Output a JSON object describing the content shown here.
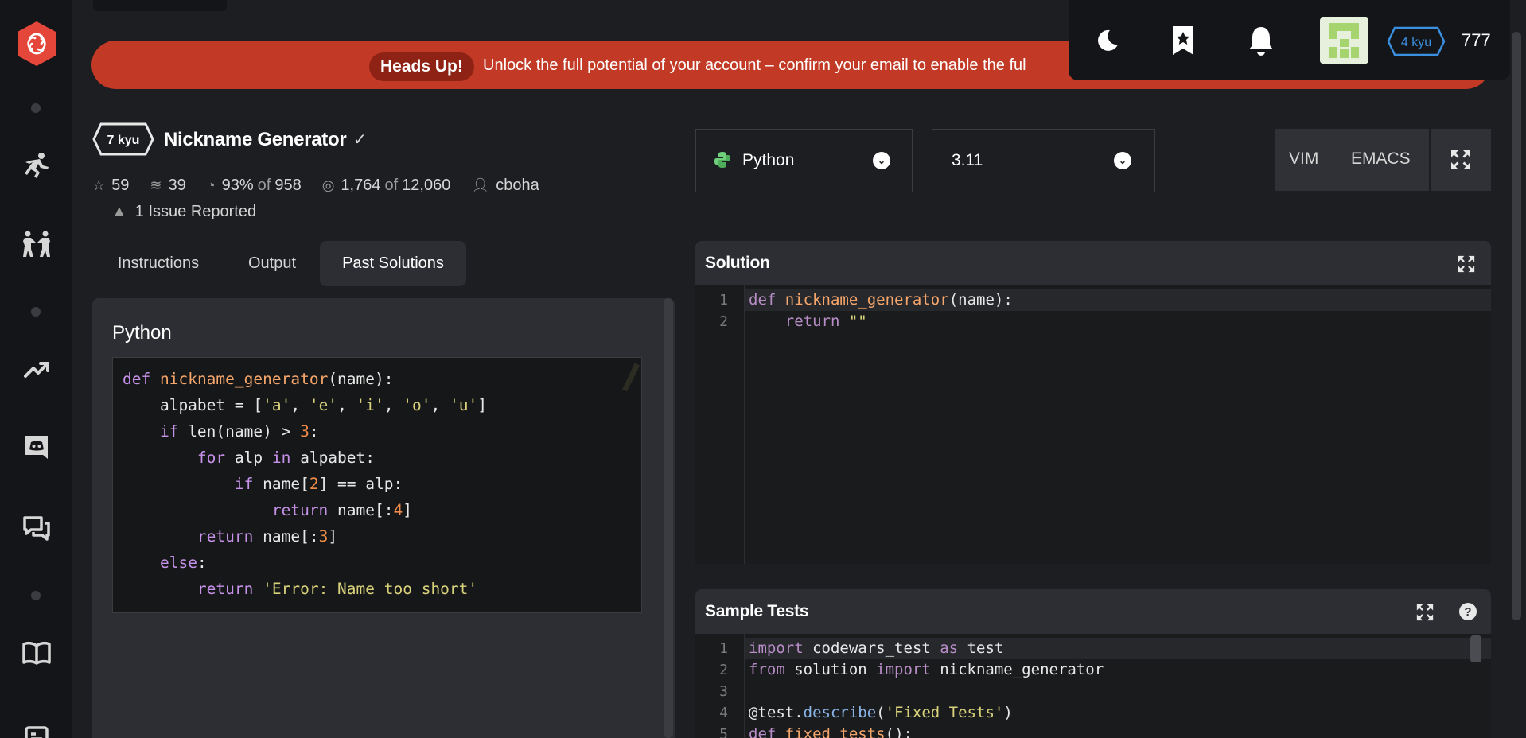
{
  "banner": {
    "pill": "Heads Up!",
    "message": "Unlock the full potential of your account – confirm your email to enable the ful"
  },
  "user": {
    "rank": "4 kyu",
    "honor": "777"
  },
  "kata": {
    "rank": "7 kyu",
    "title": "Nickname Generator",
    "check": "✓",
    "stars": "59",
    "collections": "39",
    "satisfaction_pct": "93%",
    "satisfaction_of": "of",
    "satisfaction_votes": "958",
    "completed": "1,764",
    "completed_of": "of",
    "completed_total": "12,060",
    "author": "cboha",
    "issues": "1 Issue Reported"
  },
  "tabs": [
    "Instructions",
    "Output",
    "Past Solutions"
  ],
  "past_solution": {
    "language": "Python"
  },
  "editor": {
    "language": "Python",
    "version": "3.11",
    "modes": [
      "VIM",
      "EMACS"
    ],
    "solution_title": "Solution",
    "tests_title": "Sample Tests",
    "solution_line_numbers": [
      "1",
      "2"
    ],
    "tests_line_numbers": [
      "1",
      "2",
      "3",
      "4",
      "5"
    ]
  },
  "colors": {
    "banner": "#c23a26",
    "logo": "#e4473a",
    "rank_blue": "#3b8fe0"
  },
  "icons": [
    "logo-icon",
    "training-icon",
    "practice-icon",
    "leaderboard-icon",
    "discord-icon",
    "chat-icon",
    "docs-icon",
    "moon-icon",
    "bookmark-icon",
    "bell-icon",
    "expand-icon",
    "help-icon"
  ]
}
